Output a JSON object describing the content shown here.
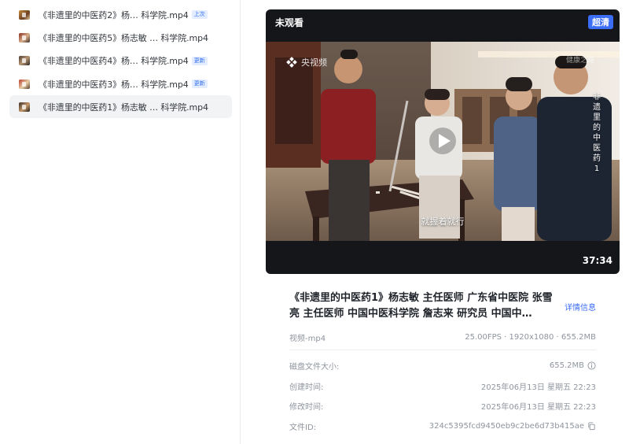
{
  "files": [
    {
      "name": "《非遗里的中医药2》杨…  科学院.mp4",
      "badge": "上次"
    },
    {
      "name": "《非遗里的中医药5》杨志敏 …  科学院.mp4",
      "badge": ""
    },
    {
      "name": "《非遗里的中医药4》杨…  科学院.mp4",
      "badge": "更新"
    },
    {
      "name": "《非遗里的中医药3》杨…  科学院.mp4",
      "badge": "更新"
    },
    {
      "name": "《非遗里的中医药1》杨志敏 …  科学院.mp4",
      "badge": "",
      "selected": true
    }
  ],
  "preview": {
    "watch_state": "未观看",
    "quality": "超清",
    "duration": "37:34",
    "channel": "央视频",
    "subtitle": "就握着就行",
    "vertical_title": "非遗里的中医药1",
    "corner_mark": "健康之路"
  },
  "info": {
    "title": "《非遗里的中医药1》杨志敏 主任医师 广东省中医院 张雪亮 主任医师 中国中医科学院 詹志来 研究员 中国中…",
    "details_link": "详情信息",
    "type": "视频-mp4",
    "specs": "25.00FPS · 1920x1080 · 655.2MB",
    "rows": [
      {
        "label": "磁盘文件大小:",
        "value": "655.2MB"
      },
      {
        "label": "创建时间:",
        "value": "2025年06月13日 星期五 22:23"
      },
      {
        "label": "修改时间:",
        "value": "2025年06月13日 星期五 22:23"
      },
      {
        "label": "文件ID:",
        "value": "324c5395fcd9450eb9c2be6d73b415ae"
      }
    ]
  }
}
